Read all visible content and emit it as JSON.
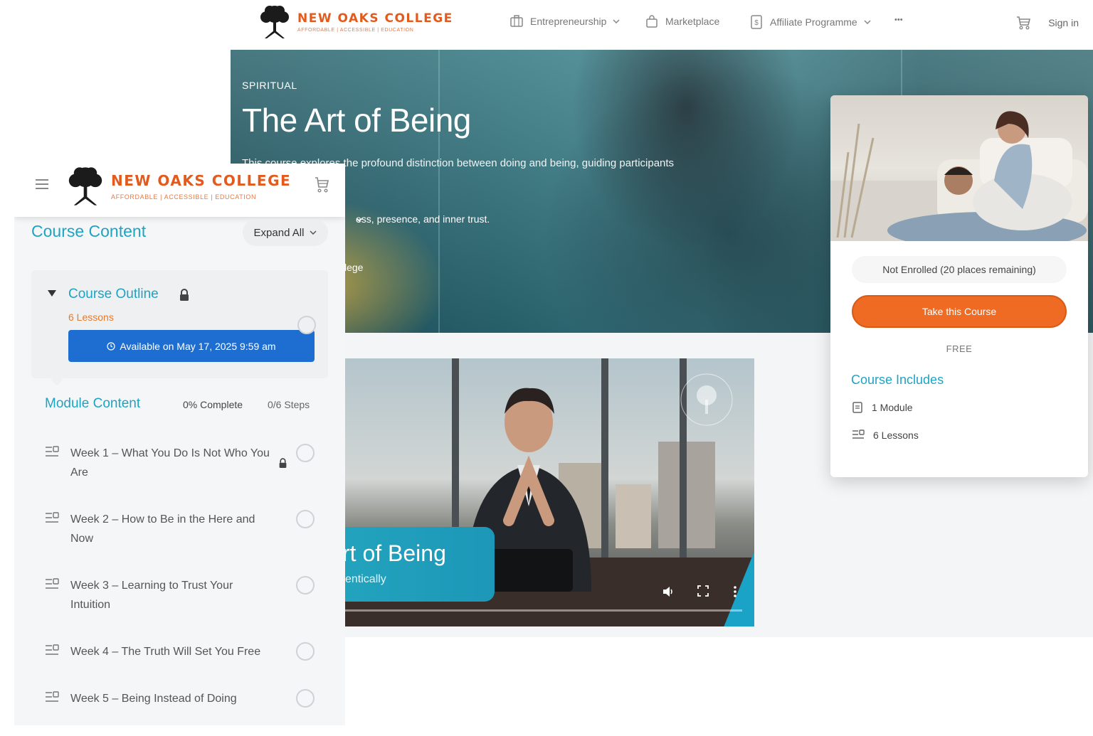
{
  "brand": {
    "name": "NEW OAKS COLLEGE",
    "tagline": "AFFORDABLE | ACCESSIBLE | EDUCATION"
  },
  "topnav": {
    "items": [
      {
        "label": "Entrepreneurship",
        "icon": "briefcase-icon",
        "dropdown": true
      },
      {
        "label": "Marketplace",
        "icon": "shopping-bag-icon",
        "dropdown": false
      },
      {
        "label": "Affiliate Programme",
        "icon": "dollar-doc-icon",
        "dropdown": true
      }
    ],
    "more_label": "•••",
    "signin_label": "Sign in"
  },
  "hero": {
    "category": "SPIRITUAL",
    "title": "The Art of Being",
    "description": "This course explores the profound distinction between doing and being, guiding participants",
    "description_frag": "ess, presence, and inner trust.",
    "frag_lege": "lege"
  },
  "video": {
    "banner_title": "rt of Being",
    "banner_sub": "entically"
  },
  "enroll_card": {
    "status": "Not Enrolled (20 places remaining)",
    "cta_label": "Take this Course",
    "price": "FREE",
    "includes_title": "Course Includes",
    "includes": [
      {
        "label": "1 Module",
        "icon": "module-icon"
      },
      {
        "label": "6 Lessons",
        "icon": "lessons-icon"
      }
    ]
  },
  "mobile": {
    "section_title": "Course Content",
    "expand_label": "Expand All",
    "outline": {
      "title": "Course Outline",
      "count": "6 Lessons",
      "available": "Available on May 17, 2025 9:59 am"
    },
    "module": {
      "title": "Module Content",
      "progress": "0% Complete",
      "steps": "0/6 Steps"
    },
    "lessons": [
      {
        "title": "Week 1 – What You Do Is Not Who You Are",
        "locked": true
      },
      {
        "title": "Week 2 – How to Be in the Here and Now",
        "locked": false
      },
      {
        "title": "Week 3 – Learning to Trust Your Intuition",
        "locked": false
      },
      {
        "title": "Week 4 – The Truth Will Set You Free",
        "locked": false
      },
      {
        "title": "Week 5 – Being Instead of Doing",
        "locked": false
      }
    ]
  },
  "colors": {
    "brand_orange": "#e35a1c",
    "accent_teal": "#1fa3c2",
    "cta_orange": "#ef6a22",
    "available_blue": "#1d6ed0"
  }
}
